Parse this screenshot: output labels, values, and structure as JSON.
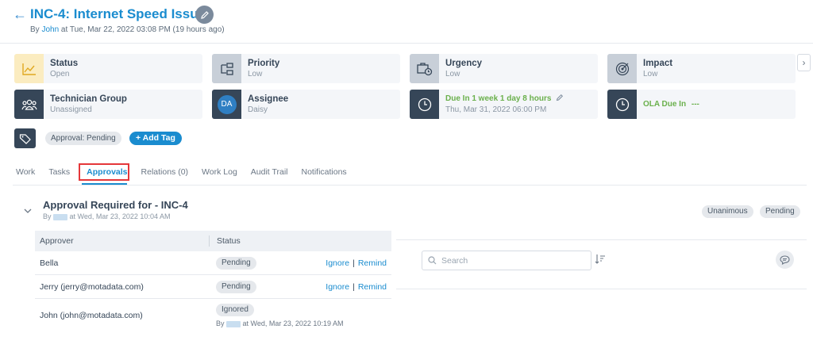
{
  "header": {
    "title": "INC-4: Internet Speed Issue",
    "by_prefix": "By",
    "user": "John",
    "meta": "at Tue, Mar 22, 2022 03:08 PM (19 hours ago)"
  },
  "cards": {
    "status": {
      "label": "Status",
      "value": "Open"
    },
    "priority": {
      "label": "Priority",
      "value": "Low"
    },
    "urgency": {
      "label": "Urgency",
      "value": "Low"
    },
    "impact": {
      "label": "Impact",
      "value": "Low"
    },
    "technician_group": {
      "label": "Technician Group",
      "value": "Unassigned"
    },
    "assignee": {
      "label": "Assignee",
      "value": "Daisy",
      "avatar": "DA"
    },
    "due": {
      "label": "Due In",
      "remaining": "1 week 1 day 8 hours",
      "value": "Thu, Mar 31, 2022 06:00 PM"
    },
    "ola": {
      "label": "OLA Due In",
      "value": "---"
    }
  },
  "tags": {
    "items": [
      "Approval: Pending"
    ],
    "add_label": "+ Add Tag"
  },
  "tabs": [
    {
      "label": "Work"
    },
    {
      "label": "Tasks"
    },
    {
      "label": "Approvals",
      "active": true
    },
    {
      "label": "Relations (0)"
    },
    {
      "label": "Work Log"
    },
    {
      "label": "Audit Trail"
    },
    {
      "label": "Notifications"
    }
  ],
  "approval": {
    "title": "Approval Required for - INC-4",
    "by_prefix": "By",
    "meta": "at Wed, Mar 23, 2022 10:04 AM",
    "badges": [
      "Unanimous",
      "Pending"
    ],
    "columns": [
      "Approver",
      "Status"
    ],
    "rows": [
      {
        "approver": "Bella",
        "status": "Pending",
        "ignore": "Ignore",
        "remind": "Remind"
      },
      {
        "approver": "Jerry (jerry@motadata.com)",
        "status": "Pending",
        "ignore": "Ignore",
        "remind": "Remind"
      },
      {
        "approver": "John (john@motadata.com)",
        "status": "Ignored",
        "by_prefix": "By",
        "by_meta": "at Wed, Mar 23, 2022 10:19 AM"
      }
    ]
  },
  "search": {
    "placeholder": "Search"
  },
  "colors": {
    "accent": "#1a8ccf",
    "dark": "#364658",
    "due_green": "#6ab04c",
    "highlight": "#e5373a"
  }
}
